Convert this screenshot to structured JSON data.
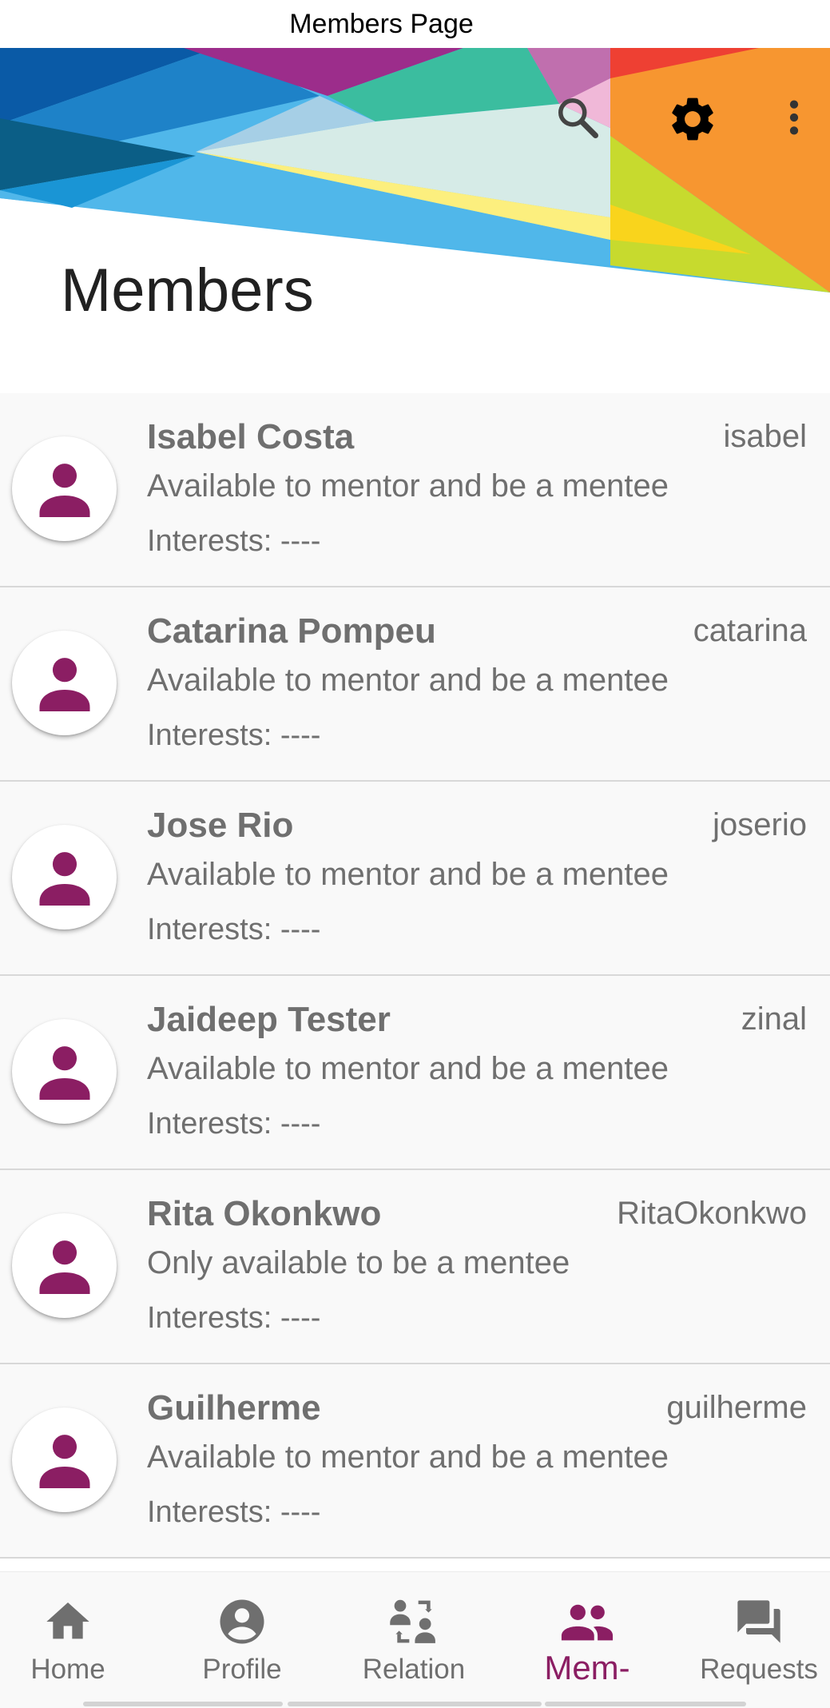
{
  "window": {
    "title": "Members Page"
  },
  "header": {
    "title": "Members",
    "icons": [
      "search-icon",
      "gear-icon",
      "more-vert-icon"
    ]
  },
  "members": [
    {
      "name": "Isabel Costa",
      "username": "isabel",
      "availability": "Available to mentor and be a mentee",
      "interests": "Interests: ----"
    },
    {
      "name": "Catarina Pompeu",
      "username": "catarina",
      "availability": "Available to mentor and be a mentee",
      "interests": "Interests: ----"
    },
    {
      "name": "Jose Rio",
      "username": "joserio",
      "availability": "Available to mentor and be a mentee",
      "interests": "Interests: ----"
    },
    {
      "name": "Jaideep Tester",
      "username": "zinal",
      "availability": "Available to mentor and be a mentee",
      "interests": "Interests: ----"
    },
    {
      "name": "Rita Okonkwo",
      "username": "RitaOkonkwo",
      "availability": "Only available to be a mentee",
      "interests": "Interests: ----"
    },
    {
      "name": "Guilherme",
      "username": "guilherme",
      "availability": "Available to mentor and be a mentee",
      "interests": "Interests: ----"
    }
  ],
  "nav": {
    "items": [
      {
        "label": "Home",
        "icon": "home-icon"
      },
      {
        "label": "Profile",
        "icon": "account-circle-icon"
      },
      {
        "label": "Relation",
        "icon": "relation-icon"
      },
      {
        "label": "Mem-",
        "icon": "people-icon",
        "active": true
      },
      {
        "label": "Requests",
        "icon": "forum-icon"
      }
    ]
  },
  "colors": {
    "accent": "#8b1e63",
    "text_secondary": "#6f6f6f",
    "list_background": "#f9f9f9",
    "divider": "#d8d8d8"
  }
}
